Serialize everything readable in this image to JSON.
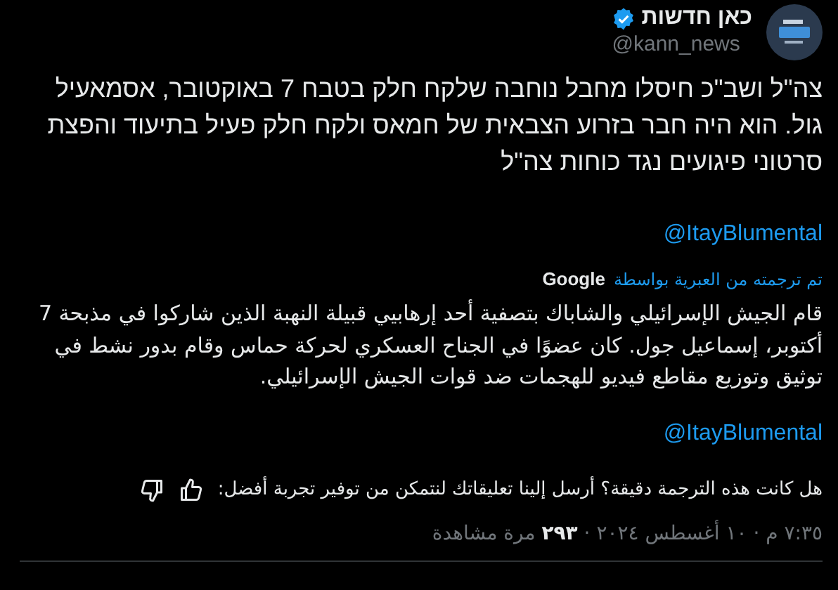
{
  "author": {
    "name": "כאן חדשות",
    "handle": "@kann_news",
    "verified": true
  },
  "text": "צה\"ל ושב\"כ חיסלו מחבל נוחבה שלקח חלק בטבח 7 באוקטובר, אסמאעיל גול. הוא היה חבר בזרוע הצבאית של חמאס ולקח חלק פעיל בתיעוד והפצת סרטוני פיגועים נגד כוחות צה\"ל",
  "mention": "@ItayBlumental",
  "translation": {
    "label": "تم ترجمته من العبرية بواسطة",
    "provider": "Google",
    "text": "قام الجيش الإسرائيلي والشاباك بتصفية أحد إرهابيي قبيلة النهبة الذين شاركوا في مذبحة 7 أكتوبر، إسماعيل جول. كان عضوًا في الجناح العسكري لحركة حماس وقام بدور نشط في توثيق وتوزيع مقاطع فيديو للهجمات ضد قوات الجيش الإسرائيلي.",
    "mention": "@ItayBlumental",
    "feedback": "هل كانت هذه الترجمة دقيقة؟ أرسل إلينا تعليقاتك لنتمكن من توفير تجربة أفضل:"
  },
  "meta": "٧:٣٥ م · ١٠ أغسطس ٢٠٢٤ · **٢٩٣** مرة مشاهدة"
}
